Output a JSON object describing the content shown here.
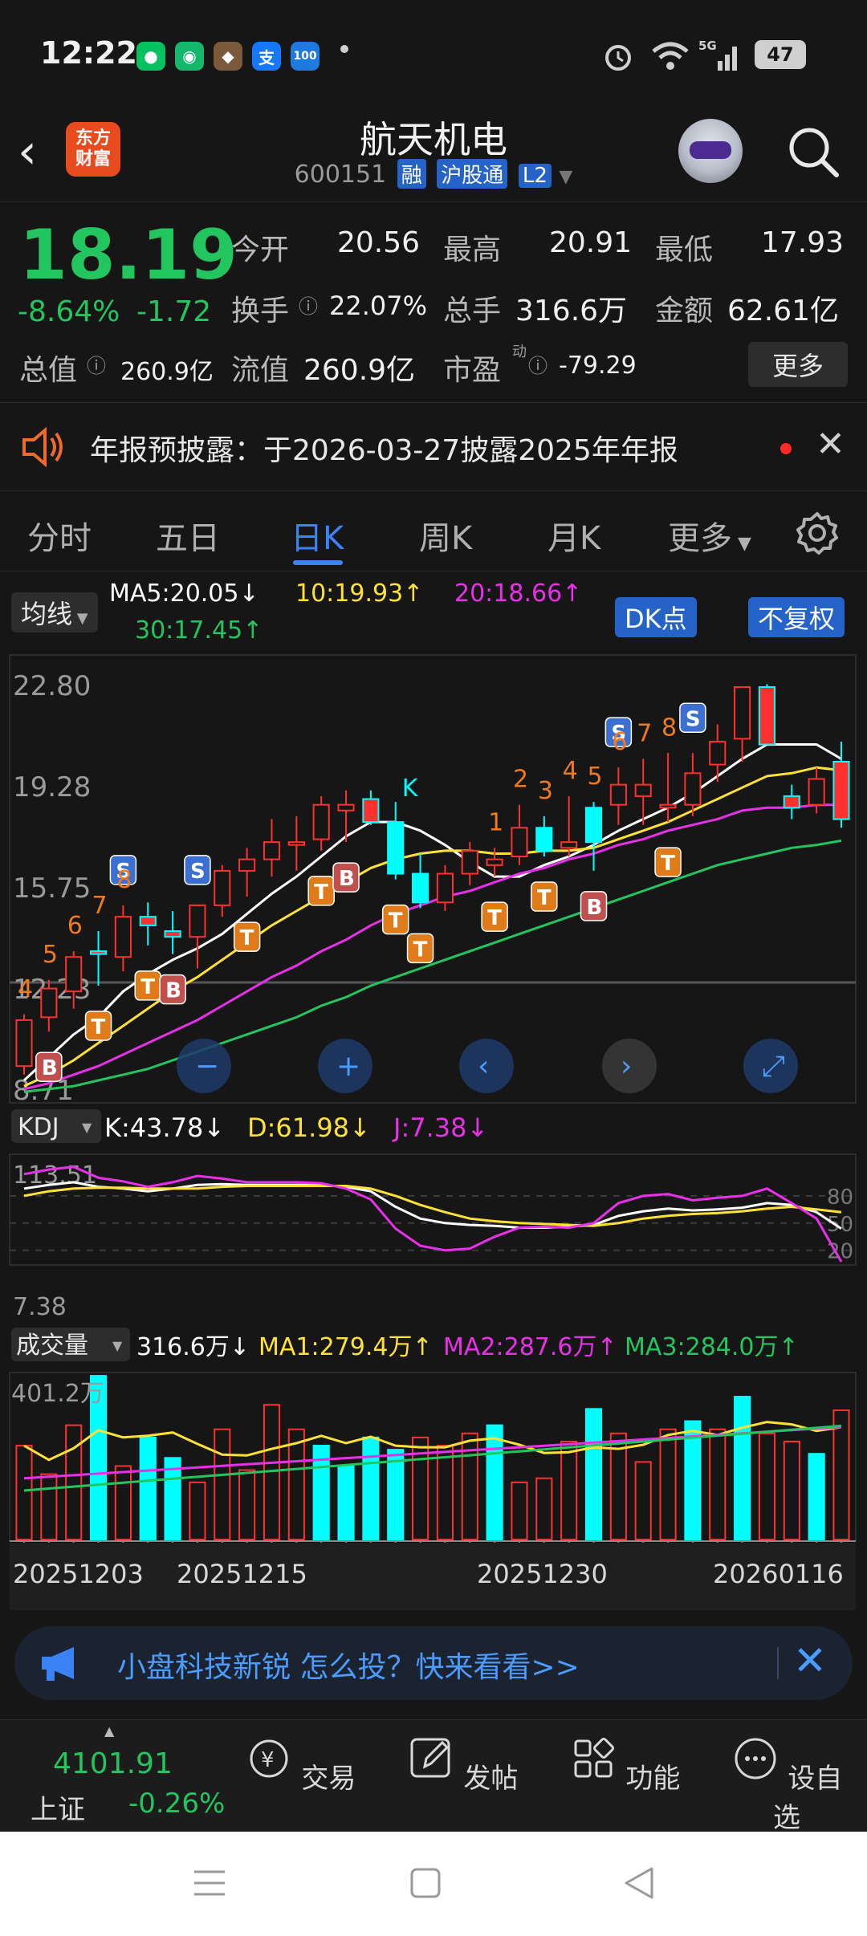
{
  "status_bar": {
    "time": "12:22",
    "battery": "47",
    "signal": "5G"
  },
  "header": {
    "logo_line1": "东方",
    "logo_line2": "财富",
    "stock_name": "航天机电",
    "stock_code": "600151",
    "tags": [
      "融",
      "沪股通",
      "L2"
    ]
  },
  "quote": {
    "price": "18.19",
    "change_pct": "-8.64%",
    "change_amt": "-1.72",
    "open_label": "今开",
    "open_value": "20.56",
    "high_label": "最高",
    "high_value": "20.91",
    "low_label": "最低",
    "low_value": "17.93",
    "turnover_label": "换手",
    "turnover_value": "22.07%",
    "volume_label": "总手",
    "volume_value": "316.6万",
    "amount_label": "金额",
    "amount_value": "62.61亿",
    "mktcap_label": "总值",
    "mktcap_value": "260.9亿",
    "float_label": "流值",
    "float_value": "260.9亿",
    "pe_label": "市盈",
    "pe_sup": "动",
    "pe_value": "-79.29",
    "more_label": "更多"
  },
  "notice": {
    "text": "年报预披露：于2026-03-27披露2025年年报"
  },
  "tabs": [
    {
      "label": "分时"
    },
    {
      "label": "五日"
    },
    {
      "label": "日K"
    },
    {
      "label": "周K"
    },
    {
      "label": "月K"
    },
    {
      "label": "更多"
    }
  ],
  "chart_header": {
    "indicator_select": "均线",
    "ma5": "MA5:20.05↓",
    "ma10": "10:19.93↑",
    "ma20": "20:18.66↑",
    "ma30": "30:17.45↑",
    "dk_button": "DK点",
    "adjust_button": "不复权"
  },
  "price_axis": [
    "22.80",
    "19.28",
    "15.75",
    "12.23",
    "8.71"
  ],
  "kdj": {
    "select": "KDJ",
    "k": "K:43.78↓",
    "d": "D:61.98↓",
    "j": "J:7.38↓",
    "axis_top": "113.51",
    "axis_bottom": "7.38",
    "levels": [
      "80",
      "50",
      "20"
    ]
  },
  "volume": {
    "select": "成交量",
    "value": "316.6万↓",
    "ma1": "MA1:279.4万↑",
    "ma2": "MA2:287.6万↑",
    "ma3": "MA3:284.0万↑",
    "axis_top": "401.2万"
  },
  "date_axis": [
    "20251203",
    "20251215",
    "20251230",
    "20260116"
  ],
  "chart_data": {
    "type": "candlestick",
    "title": "",
    "candles": [
      {
        "o": 9.6,
        "h": 11.4,
        "l": 9.3,
        "c": 11.2,
        "up": true
      },
      {
        "o": 11.3,
        "h": 12.6,
        "l": 10.8,
        "c": 12.3,
        "up": true
      },
      {
        "o": 12.2,
        "h": 13.6,
        "l": 11.6,
        "c": 13.4,
        "up": true
      },
      {
        "o": 13.5,
        "h": 14.3,
        "l": 12.4,
        "c": 13.6,
        "up": false
      },
      {
        "o": 13.4,
        "h": 15.2,
        "l": 12.9,
        "c": 14.8,
        "up": true
      },
      {
        "o": 14.8,
        "h": 15.3,
        "l": 13.8,
        "c": 14.5,
        "up": false
      },
      {
        "o": 14.3,
        "h": 15.0,
        "l": 13.5,
        "c": 14.1,
        "up": false
      },
      {
        "o": 14.1,
        "h": 15.2,
        "l": 13.0,
        "c": 15.2,
        "up": true
      },
      {
        "o": 15.2,
        "h": 16.6,
        "l": 14.8,
        "c": 16.4,
        "up": true
      },
      {
        "o": 16.4,
        "h": 17.2,
        "l": 15.5,
        "c": 16.8,
        "up": true
      },
      {
        "o": 16.8,
        "h": 18.2,
        "l": 16.2,
        "c": 17.4,
        "up": true
      },
      {
        "o": 17.4,
        "h": 18.3,
        "l": 16.4,
        "c": 17.3,
        "up": true
      },
      {
        "o": 17.5,
        "h": 19.0,
        "l": 17.1,
        "c": 18.7,
        "up": true
      },
      {
        "o": 18.5,
        "h": 19.2,
        "l": 17.4,
        "c": 18.7,
        "up": true
      },
      {
        "o": 18.9,
        "h": 19.2,
        "l": 18.0,
        "c": 18.1,
        "up": false
      },
      {
        "o": 18.1,
        "h": 18.8,
        "l": 16.1,
        "c": 16.3,
        "up": false,
        "cyan": true
      },
      {
        "o": 16.3,
        "h": 17.0,
        "l": 15.1,
        "c": 15.3,
        "up": false,
        "cyan": true
      },
      {
        "o": 15.3,
        "h": 16.6,
        "l": 15.0,
        "c": 16.3,
        "up": true
      },
      {
        "o": 16.3,
        "h": 17.4,
        "l": 15.9,
        "c": 17.1,
        "up": true
      },
      {
        "o": 16.6,
        "h": 17.2,
        "l": 16.2,
        "c": 16.8,
        "up": true
      },
      {
        "o": 16.9,
        "h": 18.7,
        "l": 16.6,
        "c": 17.9,
        "up": true
      },
      {
        "o": 17.9,
        "h": 18.3,
        "l": 16.9,
        "c": 17.1,
        "up": false,
        "cyan": true
      },
      {
        "o": 17.2,
        "h": 19.0,
        "l": 16.9,
        "c": 17.4,
        "up": true
      },
      {
        "o": 17.4,
        "h": 18.8,
        "l": 16.4,
        "c": 18.6,
        "up": false,
        "cyan": true
      },
      {
        "o": 18.7,
        "h": 20.0,
        "l": 18.0,
        "c": 19.4,
        "up": true
      },
      {
        "o": 19.4,
        "h": 20.3,
        "l": 18.0,
        "c": 19.0,
        "up": true
      },
      {
        "o": 18.7,
        "h": 20.5,
        "l": 18.1,
        "c": 18.6,
        "up": true
      },
      {
        "o": 18.7,
        "h": 20.5,
        "l": 18.3,
        "c": 19.8,
        "up": true
      },
      {
        "o": 20.1,
        "h": 21.5,
        "l": 19.5,
        "c": 20.9,
        "up": true
      },
      {
        "o": 21.0,
        "h": 22.8,
        "l": 20.2,
        "c": 22.8,
        "up": true
      },
      {
        "o": 22.8,
        "h": 22.9,
        "l": 21.0,
        "c": 20.8,
        "up": false
      },
      {
        "o": 19.0,
        "h": 19.4,
        "l": 18.2,
        "c": 18.6,
        "up": false
      },
      {
        "o": 18.7,
        "h": 20.0,
        "l": 18.4,
        "c": 19.6,
        "up": true
      },
      {
        "o": 20.2,
        "h": 20.9,
        "l": 17.9,
        "c": 18.2,
        "up": false
      }
    ],
    "price_range": [
      8.71,
      22.8
    ],
    "series": [
      {
        "name": "MA5",
        "color": "#ffffff",
        "values": [
          9.1,
          9.9,
          10.7,
          11.3,
          12.2,
          12.8,
          13.3,
          13.7,
          14.2,
          14.9,
          15.6,
          16.2,
          16.9,
          17.6,
          18.1,
          18.1,
          17.8,
          17.3,
          16.7,
          16.2,
          16.2,
          16.6,
          16.9,
          17.3,
          17.8,
          18.2,
          18.6,
          19.1,
          19.7,
          20.3,
          20.8,
          20.8,
          20.8,
          20.3
        ]
      },
      {
        "name": "MA10",
        "color": "#ffe135",
        "values": [
          8.9,
          9.3,
          9.8,
          10.4,
          11.0,
          11.6,
          12.2,
          12.7,
          13.3,
          13.9,
          14.5,
          15.0,
          15.5,
          16.0,
          16.5,
          16.8,
          17.0,
          17.1,
          17.1,
          17.0,
          17.0,
          17.1,
          17.1,
          17.2,
          17.5,
          17.8,
          18.1,
          18.5,
          18.9,
          19.3,
          19.7,
          19.8,
          20.0,
          19.9
        ]
      },
      {
        "name": "MA20",
        "color": "#e830e8",
        "values": [
          8.8,
          9.0,
          9.3,
          9.6,
          10.0,
          10.4,
          10.8,
          11.2,
          11.7,
          12.2,
          12.7,
          13.1,
          13.6,
          14.0,
          14.5,
          14.9,
          15.2,
          15.5,
          15.7,
          16.0,
          16.3,
          16.5,
          16.8,
          17.0,
          17.3,
          17.5,
          17.8,
          18.0,
          18.2,
          18.5,
          18.6,
          18.6,
          18.7,
          18.7
        ]
      },
      {
        "name": "MA30",
        "color": "#22c55e",
        "values": [
          8.7,
          8.8,
          8.9,
          9.1,
          9.3,
          9.5,
          9.8,
          10.1,
          10.4,
          10.7,
          11.0,
          11.3,
          11.7,
          12.0,
          12.4,
          12.7,
          13.0,
          13.3,
          13.6,
          13.9,
          14.2,
          14.5,
          14.8,
          15.1,
          15.4,
          15.7,
          16.0,
          16.3,
          16.6,
          16.8,
          17.0,
          17.2,
          17.3,
          17.45
        ]
      }
    ],
    "kdj": {
      "range": [
        7.38,
        113.51
      ],
      "K": [
        88,
        92,
        95,
        90,
        88,
        85,
        88,
        92,
        93,
        92,
        92,
        92,
        92,
        90,
        85,
        68,
        55,
        50,
        48,
        47,
        45,
        45,
        46,
        48,
        58,
        63,
        66,
        64,
        65,
        67,
        72,
        70,
        62,
        43.78
      ],
      "D": [
        80,
        85,
        88,
        89,
        89,
        88,
        88,
        88,
        90,
        91,
        91,
        91,
        91,
        91,
        88,
        80,
        70,
        62,
        55,
        52,
        50,
        49,
        48,
        47,
        50,
        55,
        58,
        60,
        61,
        63,
        66,
        68,
        65,
        61.98
      ],
      "J": [
        104,
        109,
        112,
        100,
        96,
        90,
        95,
        102,
        99,
        95,
        95,
        95,
        94,
        88,
        76,
        44,
        25,
        20,
        22,
        35,
        45,
        46,
        45,
        50,
        72,
        80,
        82,
        75,
        78,
        80,
        88,
        72,
        55,
        7.38
      ]
    },
    "volume_values": [
      230,
      160,
      280,
      401,
      180,
      250,
      200,
      140,
      270,
      170,
      330,
      270,
      230,
      180,
      250,
      220,
      250,
      230,
      260,
      280,
      140,
      150,
      240,
      320,
      260,
      190,
      270,
      290,
      270,
      350,
      260,
      240,
      210,
      316.6
    ],
    "volume_colors_cyan": [
      3,
      5,
      6,
      12,
      13,
      14,
      15,
      19,
      23,
      27,
      29,
      32
    ]
  },
  "banner": {
    "text": "小盘科技新锐 怎么投？快来看看>>"
  },
  "bottom_nav": {
    "index_value": "4101.91",
    "index_name": "上证",
    "index_change": "-0.26%",
    "items": [
      {
        "label": "交易"
      },
      {
        "label": "发帖"
      },
      {
        "label": "功能"
      },
      {
        "label": "设自选"
      }
    ]
  }
}
